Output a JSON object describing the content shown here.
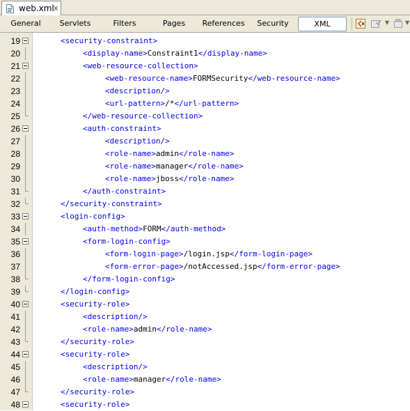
{
  "file_tab": {
    "name": "web.xml",
    "close": "x",
    "icon": "xml-file-icon"
  },
  "view_tabs": [
    {
      "label": "General",
      "active": false
    },
    {
      "label": "Servlets",
      "active": false
    },
    {
      "label": "Filters",
      "active": false
    },
    {
      "label": "Pages",
      "active": false
    },
    {
      "label": "References",
      "active": false
    },
    {
      "label": "Security",
      "active": false
    },
    {
      "label": "XML",
      "active": true
    }
  ],
  "toolbar": {
    "icons": [
      "back-to-previous-icon",
      "validate-icon",
      "dropdown-arrow-icon",
      "run-icon",
      "dropdown-arrow-icon"
    ]
  },
  "colors": {
    "tag": "#0000e6",
    "text": "#000000",
    "gutter": "#ece9d8",
    "active_tab_border": "#7f9db9"
  },
  "lines": [
    {
      "num": "19",
      "indent": 1,
      "fold": "open",
      "parts": [
        {
          "t": "tag",
          "v": "<security-constraint>"
        }
      ]
    },
    {
      "num": "20",
      "indent": 2,
      "fold": "line",
      "parts": [
        {
          "t": "tag",
          "v": "<display-name>"
        },
        {
          "t": "txt",
          "v": "Constraint1"
        },
        {
          "t": "tag",
          "v": "</display-name>"
        }
      ]
    },
    {
      "num": "21",
      "indent": 2,
      "fold": "open",
      "parts": [
        {
          "t": "tag",
          "v": "<web-resource-collection>"
        }
      ]
    },
    {
      "num": "22",
      "indent": 3,
      "fold": "line",
      "parts": [
        {
          "t": "tag",
          "v": "<web-resource-name>"
        },
        {
          "t": "txt",
          "v": "FORMSecurity"
        },
        {
          "t": "tag",
          "v": "</web-resource-name>"
        }
      ]
    },
    {
      "num": "23",
      "indent": 3,
      "fold": "line",
      "parts": [
        {
          "t": "tag",
          "v": "<description/>"
        }
      ]
    },
    {
      "num": "24",
      "indent": 3,
      "fold": "line",
      "parts": [
        {
          "t": "tag",
          "v": "<url-pattern>"
        },
        {
          "t": "txt",
          "v": "/*"
        },
        {
          "t": "tag",
          "v": "</url-pattern>"
        }
      ]
    },
    {
      "num": "25",
      "indent": 2,
      "fold": "end",
      "parts": [
        {
          "t": "tag",
          "v": "</web-resource-collection>"
        }
      ]
    },
    {
      "num": "26",
      "indent": 2,
      "fold": "open",
      "parts": [
        {
          "t": "tag",
          "v": "<auth-constraint>"
        }
      ]
    },
    {
      "num": "27",
      "indent": 3,
      "fold": "line",
      "parts": [
        {
          "t": "tag",
          "v": "<description/>"
        }
      ]
    },
    {
      "num": "28",
      "indent": 3,
      "fold": "line",
      "parts": [
        {
          "t": "tag",
          "v": "<role-name>"
        },
        {
          "t": "txt",
          "v": "admin"
        },
        {
          "t": "tag",
          "v": "</role-name>"
        }
      ]
    },
    {
      "num": "29",
      "indent": 3,
      "fold": "line",
      "parts": [
        {
          "t": "tag",
          "v": "<role-name>"
        },
        {
          "t": "txt",
          "v": "manager"
        },
        {
          "t": "tag",
          "v": "</role-name>"
        }
      ]
    },
    {
      "num": "30",
      "indent": 3,
      "fold": "line",
      "parts": [
        {
          "t": "tag",
          "v": "<role-name>"
        },
        {
          "t": "txt",
          "v": "jboss"
        },
        {
          "t": "tag",
          "v": "</role-name>"
        }
      ]
    },
    {
      "num": "31",
      "indent": 2,
      "fold": "end",
      "parts": [
        {
          "t": "tag",
          "v": "</auth-constraint>"
        }
      ]
    },
    {
      "num": "32",
      "indent": 1,
      "fold": "end",
      "parts": [
        {
          "t": "tag",
          "v": "</security-constraint>"
        }
      ]
    },
    {
      "num": "33",
      "indent": 1,
      "fold": "open",
      "parts": [
        {
          "t": "tag",
          "v": "<login-config>"
        }
      ]
    },
    {
      "num": "34",
      "indent": 2,
      "fold": "line",
      "parts": [
        {
          "t": "tag",
          "v": "<auth-method>"
        },
        {
          "t": "txt",
          "v": "FORM"
        },
        {
          "t": "tag",
          "v": "</auth-method>"
        }
      ]
    },
    {
      "num": "35",
      "indent": 2,
      "fold": "open",
      "parts": [
        {
          "t": "tag",
          "v": "<form-login-config>"
        }
      ]
    },
    {
      "num": "36",
      "indent": 3,
      "fold": "line",
      "parts": [
        {
          "t": "tag",
          "v": "<form-login-page>"
        },
        {
          "t": "txt",
          "v": "/login.jsp"
        },
        {
          "t": "tag",
          "v": "</form-login-page>"
        }
      ]
    },
    {
      "num": "37",
      "indent": 3,
      "fold": "line",
      "parts": [
        {
          "t": "tag",
          "v": "<form-error-page>"
        },
        {
          "t": "txt",
          "v": "/notAccessed.jsp"
        },
        {
          "t": "tag",
          "v": "</form-error-page>"
        }
      ]
    },
    {
      "num": "38",
      "indent": 2,
      "fold": "end",
      "parts": [
        {
          "t": "tag",
          "v": "</form-login-config>"
        }
      ]
    },
    {
      "num": "39",
      "indent": 1,
      "fold": "end",
      "parts": [
        {
          "t": "tag",
          "v": "</login-config>"
        }
      ]
    },
    {
      "num": "40",
      "indent": 1,
      "fold": "open",
      "parts": [
        {
          "t": "tag",
          "v": "<security-role>"
        }
      ]
    },
    {
      "num": "41",
      "indent": 2,
      "fold": "line",
      "parts": [
        {
          "t": "tag",
          "v": "<description/>"
        }
      ]
    },
    {
      "num": "42",
      "indent": 2,
      "fold": "line",
      "parts": [
        {
          "t": "tag",
          "v": "<role-name>"
        },
        {
          "t": "txt",
          "v": "admin"
        },
        {
          "t": "tag",
          "v": "</role-name>"
        }
      ]
    },
    {
      "num": "43",
      "indent": 1,
      "fold": "end",
      "parts": [
        {
          "t": "tag",
          "v": "</security-role>"
        }
      ]
    },
    {
      "num": "44",
      "indent": 1,
      "fold": "open",
      "parts": [
        {
          "t": "tag",
          "v": "<security-role>"
        }
      ]
    },
    {
      "num": "45",
      "indent": 2,
      "fold": "line",
      "parts": [
        {
          "t": "tag",
          "v": "<description/>"
        }
      ]
    },
    {
      "num": "46",
      "indent": 2,
      "fold": "line",
      "parts": [
        {
          "t": "tag",
          "v": "<role-name>"
        },
        {
          "t": "txt",
          "v": "manager"
        },
        {
          "t": "tag",
          "v": "</role-name>"
        }
      ]
    },
    {
      "num": "47",
      "indent": 1,
      "fold": "end",
      "parts": [
        {
          "t": "tag",
          "v": "</security-role>"
        }
      ]
    },
    {
      "num": "48",
      "indent": 1,
      "fold": "open",
      "parts": [
        {
          "t": "tag",
          "v": "<security-role>"
        }
      ]
    }
  ]
}
